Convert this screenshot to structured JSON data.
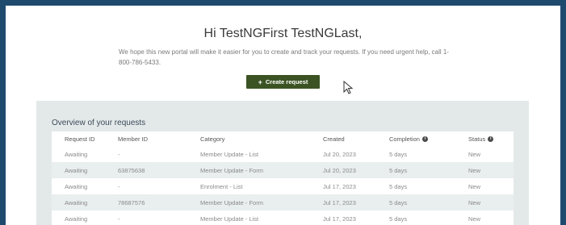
{
  "greeting": "Hi TestNGFirst TestNGLast,",
  "intro": "We hope this new portal will make it easier for you to create and track your requests. If you need urgent help, call 1-800-786-5433.",
  "create_button": {
    "icon": "+",
    "label": "Create request"
  },
  "overview": {
    "title": "Overview of your requests",
    "columns": [
      "Request ID",
      "Member ID",
      "Category",
      "Created",
      "Completion",
      "Status"
    ],
    "rows": [
      [
        "Awaiting",
        "-",
        "Member Update - List",
        "Jul 20, 2023",
        "5 days",
        "New"
      ],
      [
        "Awaiting",
        "63875638",
        "Member Update - Form",
        "Jul 20, 2023",
        "5 days",
        "New"
      ],
      [
        "Awaiting",
        "-",
        "Enrolment - List",
        "Jul 17, 2023",
        "5 days",
        "New"
      ],
      [
        "Awaiting",
        "78687576",
        "Member Update - Form",
        "Jul 17, 2023",
        "5 days",
        "New"
      ],
      [
        "Awaiting",
        "-",
        "Member Update - List",
        "Jul 17, 2023",
        "5 days",
        "New"
      ]
    ]
  },
  "colors": {
    "frame": "#1e4a6e",
    "button": "#3b5323",
    "panel": "#e3e9e9"
  }
}
